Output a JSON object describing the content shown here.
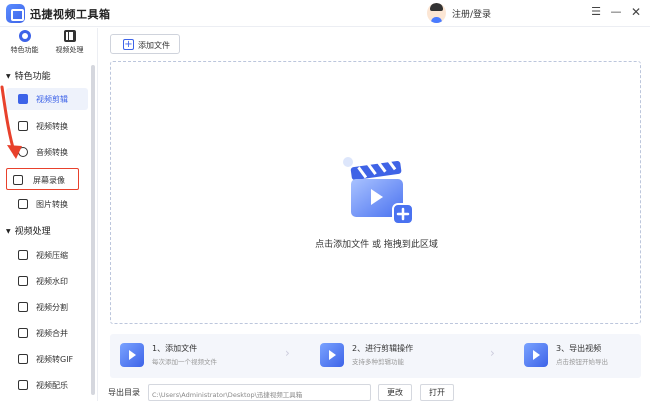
{
  "app": {
    "title": "迅捷视频工具箱"
  },
  "header": {
    "login_label": "注册/登录",
    "menu_glyph": "☰",
    "minimize_glyph": "—",
    "close_glyph": "✕"
  },
  "sidebar": {
    "tabs": [
      {
        "label": "特色功能",
        "icon": "star-circle-icon",
        "active": true
      },
      {
        "label": "视频处理",
        "icon": "film-icon",
        "active": false
      }
    ],
    "sections": [
      {
        "title": "特色功能",
        "items": [
          {
            "label": "视频剪辑",
            "icon": "video-edit-icon",
            "active": true
          },
          {
            "label": "视频转换",
            "icon": "video-convert-icon"
          },
          {
            "label": "音频转换",
            "icon": "audio-convert-icon"
          },
          {
            "label": "屏幕录像",
            "icon": "screen-record-icon",
            "highlighted": true
          },
          {
            "label": "图片转换",
            "icon": "image-convert-icon"
          }
        ]
      },
      {
        "title": "视频处理",
        "items": [
          {
            "label": "视频压缩",
            "icon": "video-compress-icon"
          },
          {
            "label": "视频水印",
            "icon": "video-watermark-icon"
          },
          {
            "label": "视频分割",
            "icon": "video-split-icon"
          },
          {
            "label": "视频合并",
            "icon": "video-merge-icon"
          },
          {
            "label": "视频转GIF",
            "icon": "video-gif-icon"
          },
          {
            "label": "视频配乐",
            "icon": "video-music-icon"
          }
        ]
      }
    ]
  },
  "main": {
    "add_button_label": "添加文件",
    "dropzone_text": "点击添加文件 或 拖拽到此区域",
    "steps": [
      {
        "title": "1、添加文件",
        "desc": "每次添加一个视频文件"
      },
      {
        "title": "2、进行剪辑操作",
        "desc": "支持多种剪辑功能"
      },
      {
        "title": "3、导出视频",
        "desc": "点击按钮开始导出"
      }
    ],
    "output": {
      "label": "导出目录",
      "path": "C:\\Users\\Administrator\\Desktop\\迅捷视频工具箱",
      "change_label": "更改",
      "open_label": "打开"
    }
  },
  "colors": {
    "accent": "#3d63e8",
    "highlight_border": "#e8412c",
    "arrow": "#e8412c"
  }
}
